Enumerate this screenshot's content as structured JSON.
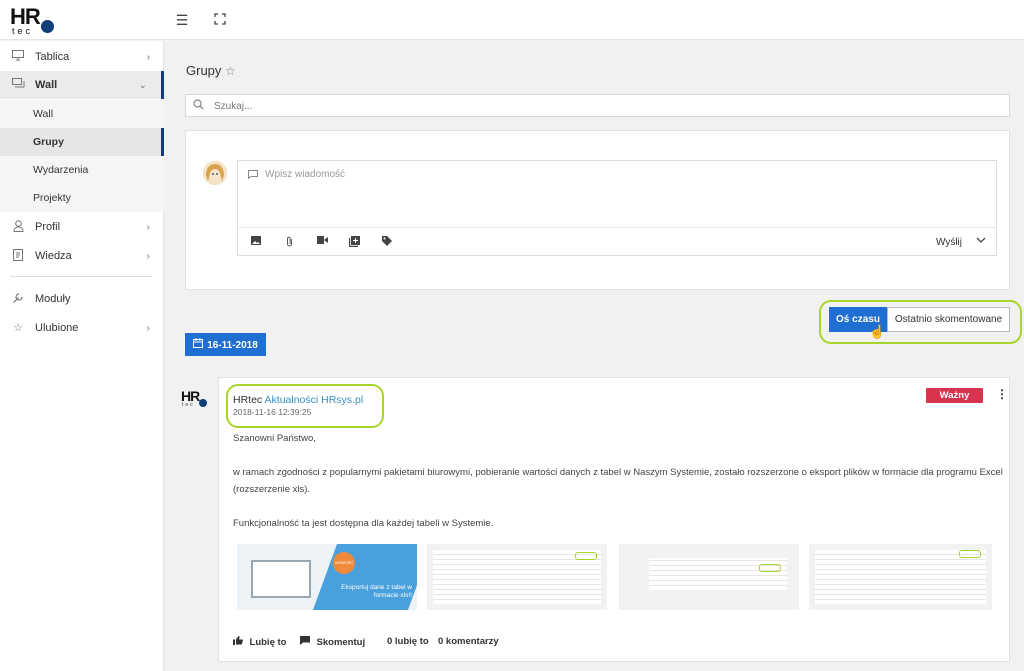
{
  "logo": {
    "hr": "HR",
    "tec": "tec"
  },
  "topbar": {
    "menu_icon": "hamburger-icon",
    "fullscreen_icon": "fullscreen-icon"
  },
  "sidebar": {
    "items": [
      {
        "label": "Tablica",
        "icon": "monitor-icon"
      },
      {
        "label": "Wall",
        "icon": "chat-icon"
      },
      {
        "label": "Profil",
        "icon": "user-icon"
      },
      {
        "label": "Wiedza",
        "icon": "book-icon"
      },
      {
        "label": "Moduły",
        "icon": "wrench-icon"
      },
      {
        "label": "Ulubione",
        "icon": "star-icon"
      }
    ],
    "wall_sub": [
      "Wall",
      "Grupy",
      "Wydarzenia",
      "Projekty"
    ]
  },
  "page": {
    "title": "Grupy"
  },
  "search": {
    "placeholder": "Szukaj..."
  },
  "compose": {
    "placeholder": "Wpisz wiadomość",
    "send_label": "Wyślij"
  },
  "view_toggle": {
    "timeline": "Oś czasu",
    "recent": "Ostatnio skomentowane"
  },
  "date_button": "16-11-2018",
  "post": {
    "author": "HRtec",
    "group": "Aktualności HRsys.pl",
    "timestamp": "2018-11-16 12:39:25",
    "badge": "Ważny",
    "greeting": "Szanowni Państwo,",
    "body1": "w ramach zgodności z popularnymi pakietami biurowymi, pobieranie wartości  danych z tabel w Naszym Systemie, zostało rozszerzone o eksport plików w formacie dla programu Excel (rozszerzenie xls).",
    "body2": "Funkcjonalność ta jest dostępna dla każdej tabeli w Systemie.",
    "thumb_badge": "NOWOŚĆ",
    "thumb_caption": "Eksportuj dane z tabel w formacie xls!!",
    "like_label": "Lubię to",
    "comment_label": "Skomentuj",
    "likes_count": "0 lubię to",
    "comments_count": "0 komentarzy"
  },
  "colors": {
    "accent": "#1f6fd2",
    "brand": "#0f3e7a",
    "badge": "#d9344f",
    "highlight": "#a7d62a"
  }
}
